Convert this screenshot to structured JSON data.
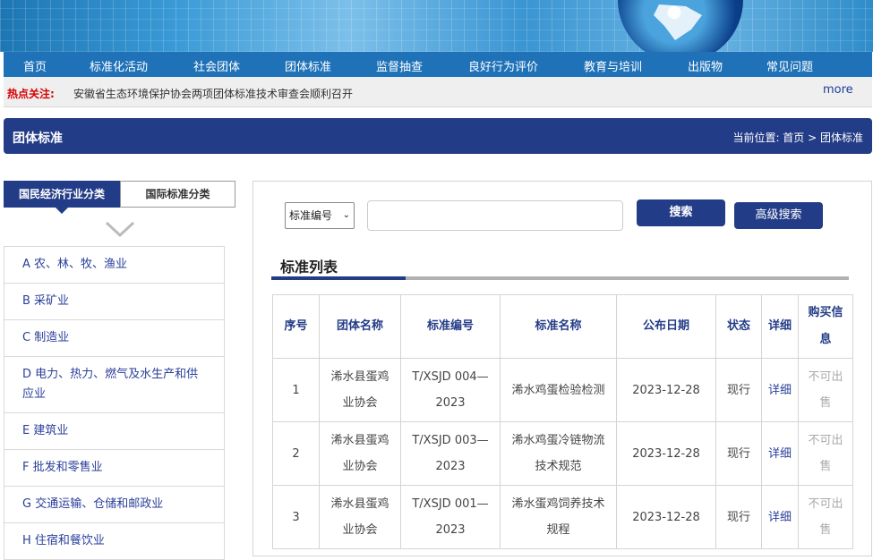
{
  "nav": {
    "items": [
      "首页",
      "标准化活动",
      "社会团体",
      "团体标准",
      "监督抽查",
      "良好行为评价",
      "教育与培训",
      "出版物",
      "常见问题"
    ]
  },
  "hot": {
    "label": "热点关注:",
    "text": "安徽省生态环境保护协会两项团体标准技术审查会顺利召开",
    "more": "more"
  },
  "page": {
    "title": "团体标准",
    "breadcrumb": "当前位置:  首页 > 团体标准"
  },
  "tabs": {
    "industry": "国民经济行业分类",
    "international": "国际标准分类"
  },
  "categories": [
    "A 农、林、牧、渔业",
    "B 采矿业",
    "C 制造业",
    "D 电力、热力、燃气及水生产和供应业",
    "E 建筑业",
    "F 批发和零售业",
    "G 交通运输、仓储和邮政业",
    "H 住宿和餐饮业"
  ],
  "search": {
    "select_value": "标准编号",
    "input_value": "",
    "search_button": "搜索",
    "advanced_button": "高级搜索"
  },
  "list": {
    "title": "标准列表",
    "headers": [
      "序号",
      "团体名称",
      "标准编号",
      "标准名称",
      "公布日期",
      "状态",
      "详细",
      "购买信息"
    ],
    "rows": [
      {
        "no": "1",
        "org": "浠水县蛋鸡业协会",
        "code": "T/XSJD 004—2023",
        "name": "浠水鸡蛋检验检测",
        "date": "2023-12-28",
        "status": "现行",
        "detail": "详细",
        "buy": "不可出售"
      },
      {
        "no": "2",
        "org": "浠水县蛋鸡业协会",
        "code": "T/XSJD 003—2023",
        "name": "浠水鸡蛋冷链物流技术规范",
        "date": "2023-12-28",
        "status": "现行",
        "detail": "详细",
        "buy": "不可出售"
      },
      {
        "no": "3",
        "org": "浠水县蛋鸡业协会",
        "code": "T/XSJD 001—2023",
        "name": "浠水蛋鸡饲养技术规程",
        "date": "2023-12-28",
        "status": "现行",
        "detail": "详细",
        "buy": "不可出售"
      }
    ]
  }
}
